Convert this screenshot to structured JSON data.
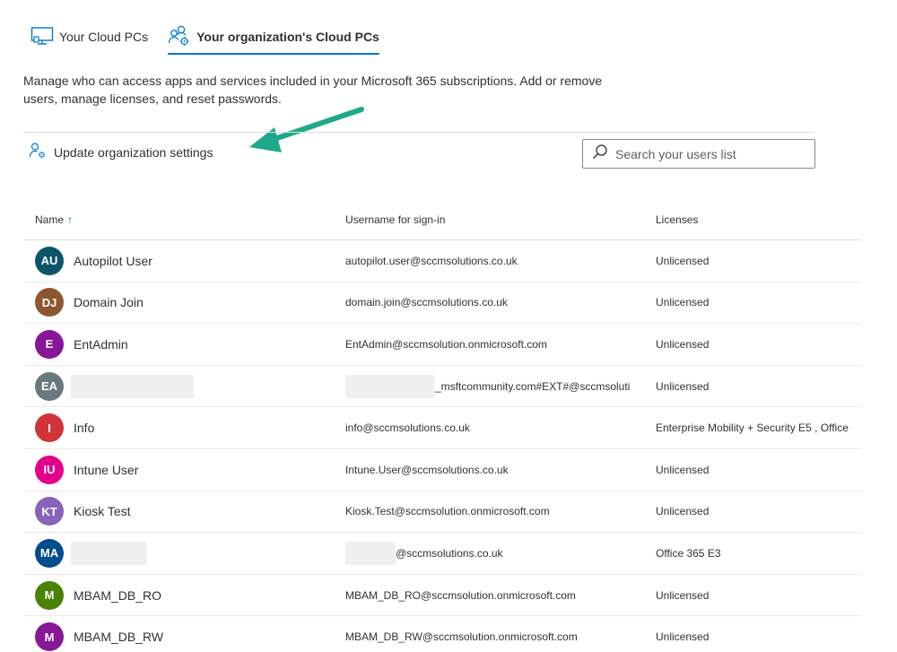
{
  "tabs": [
    {
      "label": "Your Cloud PCs",
      "icon": "monitor-icon",
      "active": false
    },
    {
      "label": "Your organization's Cloud PCs",
      "icon": "people-settings-icon",
      "active": true
    }
  ],
  "description": "Manage who can access apps and services included in your Microsoft 365 subscriptions. Add or remove users, manage licenses, and reset passwords.",
  "command": {
    "label": "Update organization settings",
    "icon": "person-settings-icon"
  },
  "search": {
    "placeholder": "Search your users list",
    "icon": "search-icon"
  },
  "table": {
    "headers": {
      "name": "Name",
      "username": "Username for sign-in",
      "licenses": "Licenses"
    },
    "sort_icon": "arrow-up-icon",
    "rows": [
      {
        "initials": "AU",
        "color": "#0b556a",
        "name": "Autopilot User",
        "username": "autopilot.user@sccmsolutions.co.uk",
        "license": "Unlicensed"
      },
      {
        "initials": "DJ",
        "color": "#8e562e",
        "name": "Domain Join",
        "username": "domain.join@sccmsolutions.co.uk",
        "license": "Unlicensed"
      },
      {
        "initials": "E",
        "color": "#881798",
        "name": "EntAdmin",
        "username": "EntAdmin@sccmsolution.onmicrosoft.com",
        "license": "Unlicensed"
      },
      {
        "initials": "EA",
        "color": "#69797e",
        "name": "",
        "username": "_msftcommunity.com#EXT#@sccmsoluti",
        "license": "Unlicensed",
        "redacted": true
      },
      {
        "initials": "I",
        "color": "#d13438",
        "name": "Info",
        "username": "info@sccmsolutions.co.uk",
        "license": "Enterprise Mobility + Security E5 , Office"
      },
      {
        "initials": "IU",
        "color": "#e3008c",
        "name": "Intune User",
        "username": "Intune.User@sccmsolutions.co.uk",
        "license": "Unlicensed"
      },
      {
        "initials": "KT",
        "color": "#8764b8",
        "name": "Kiosk Test",
        "username": "Kiosk.Test@sccmsolution.onmicrosoft.com",
        "license": "Unlicensed"
      },
      {
        "initials": "MA",
        "color": "#004e8c",
        "name": "",
        "username": "@sccmsolutions.co.uk",
        "license": "Office 365 E3",
        "redacted": true
      },
      {
        "initials": "M",
        "color": "#498205",
        "name": "MBAM_DB_RO",
        "username": "MBAM_DB_RO@sccmsolution.onmicrosoft.com",
        "license": "Unlicensed"
      },
      {
        "initials": "M",
        "color": "#881798",
        "name": "MBAM_DB_RW",
        "username": "MBAM_DB_RW@sccmsolution.onmicrosoft.com",
        "license": "Unlicensed"
      }
    ]
  },
  "colors": {
    "accent": "#0078d4",
    "annotation_arrow": "#1fa98a"
  }
}
